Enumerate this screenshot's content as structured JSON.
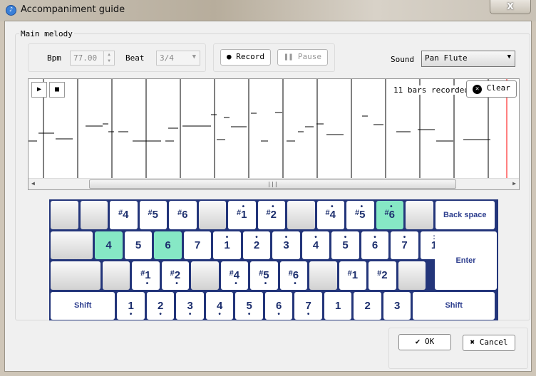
{
  "window": {
    "title": "Accompaniment guide",
    "close_label": "X"
  },
  "group_label": "Main melody",
  "tempo": {
    "bpm_label": "Bpm",
    "bpm_value": "77.00",
    "beat_label": "Beat",
    "beat_value": "3/4"
  },
  "record": {
    "record_label": "Record",
    "pause_label": "Pause"
  },
  "sound": {
    "label": "Sound",
    "value": "Pan Flute"
  },
  "roll": {
    "status": "11 bars recorded",
    "clear_label": "Clear",
    "playhead_color": "#ff0000"
  },
  "keyboard": {
    "highlight_color": "#86e8c5",
    "rows": [
      [
        {
          "t": ""
        },
        {
          "t": ""
        },
        {
          "t": "#4"
        },
        {
          "t": "#5"
        },
        {
          "t": "#6"
        },
        {
          "t": ""
        },
        {
          "t": "#1",
          "m": "hi"
        },
        {
          "t": "#2",
          "m": "hi"
        },
        {
          "t": ""
        },
        {
          "t": "#4",
          "m": "hi"
        },
        {
          "t": "#5",
          "m": "hi"
        },
        {
          "t": "#6",
          "m": "hi",
          "on": true
        },
        {
          "t": ""
        },
        {
          "t": "Back space",
          "wide": true
        }
      ],
      [
        {
          "t": "",
          "w": 1.5
        },
        {
          "t": "4",
          "on": true
        },
        {
          "t": "5"
        },
        {
          "t": "6",
          "on": true
        },
        {
          "t": "7"
        },
        {
          "t": "1",
          "m": "hi"
        },
        {
          "t": "2",
          "m": "hi"
        },
        {
          "t": "3",
          "m": "hi"
        },
        {
          "t": "4",
          "m": "hi"
        },
        {
          "t": "5",
          "m": "hi"
        },
        {
          "t": "6",
          "m": "hi"
        },
        {
          "t": "7",
          "m": "hi"
        },
        {
          "t": "1",
          "m": "hi2"
        }
      ],
      [
        {
          "t": "",
          "w": 1.75
        },
        {
          "t": ""
        },
        {
          "t": "#1",
          "m": "lo"
        },
        {
          "t": "#2",
          "m": "lo"
        },
        {
          "t": ""
        },
        {
          "t": "#4",
          "m": "lo"
        },
        {
          "t": "#5",
          "m": "lo"
        },
        {
          "t": "#6",
          "m": "lo"
        },
        {
          "t": ""
        },
        {
          "t": "#1"
        },
        {
          "t": "#2"
        },
        {
          "t": ""
        }
      ],
      [
        {
          "t": "Shift",
          "wide": true,
          "w": 2.25
        },
        {
          "t": "1",
          "m": "lo"
        },
        {
          "t": "2",
          "m": "lo"
        },
        {
          "t": "3",
          "m": "lo"
        },
        {
          "t": "4",
          "m": "lo"
        },
        {
          "t": "5",
          "m": "lo"
        },
        {
          "t": "6",
          "m": "lo"
        },
        {
          "t": "7",
          "m": "lo"
        },
        {
          "t": "1"
        },
        {
          "t": "2"
        },
        {
          "t": "3"
        },
        {
          "t": "Shift",
          "wide": true,
          "w": 2.75
        }
      ]
    ],
    "enter_label": "Enter"
  },
  "footer": {
    "ok_label": "OK",
    "cancel_label": "Cancel"
  }
}
